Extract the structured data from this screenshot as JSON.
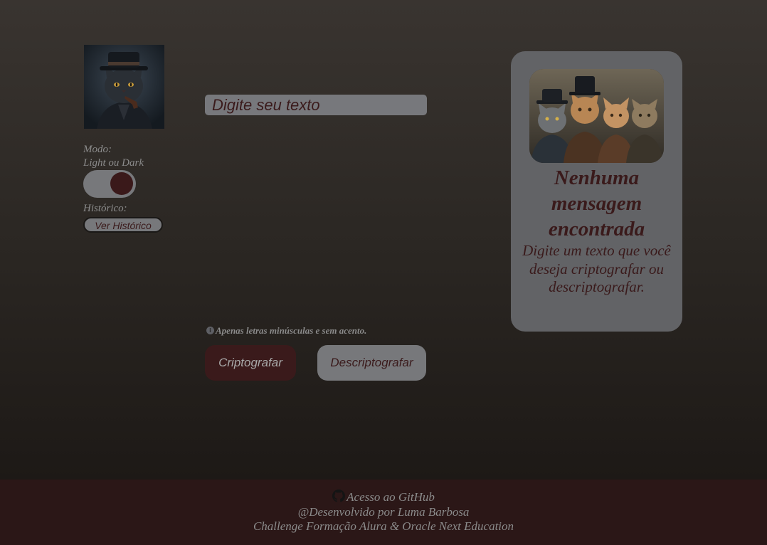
{
  "sidebar": {
    "mode_label": "Modo:",
    "mode_sublabel": "Light ou Dark",
    "theme_toggle": {
      "state": "dark"
    },
    "history_label": "Histórico:",
    "history_button": "Ver Histórico"
  },
  "main": {
    "input_placeholder": "Digite seu texto",
    "input_value": "",
    "hint": "Apenas letras minúsculas e sem acento.",
    "encrypt_button": "Criptografar",
    "decrypt_button": "Descriptografar"
  },
  "result_panel": {
    "title": "Nenhuma mensagem encontrada",
    "message": "Digite um texto que você deseja criptografar ou descriptografar."
  },
  "footer": {
    "github_link": "Acesso ao GitHub",
    "credit": "@Desenvolvido por Luma Barbosa",
    "challenge": "Challenge Formação Alura & Oracle Next Education"
  },
  "colors": {
    "accent_wine": "#3a1a1b",
    "surface_gray": "#77787b",
    "panel_gray": "#626366",
    "footer_bg": "#2b1717"
  },
  "icons": [
    "cat-detective-logo",
    "info-icon",
    "github-icon"
  ]
}
